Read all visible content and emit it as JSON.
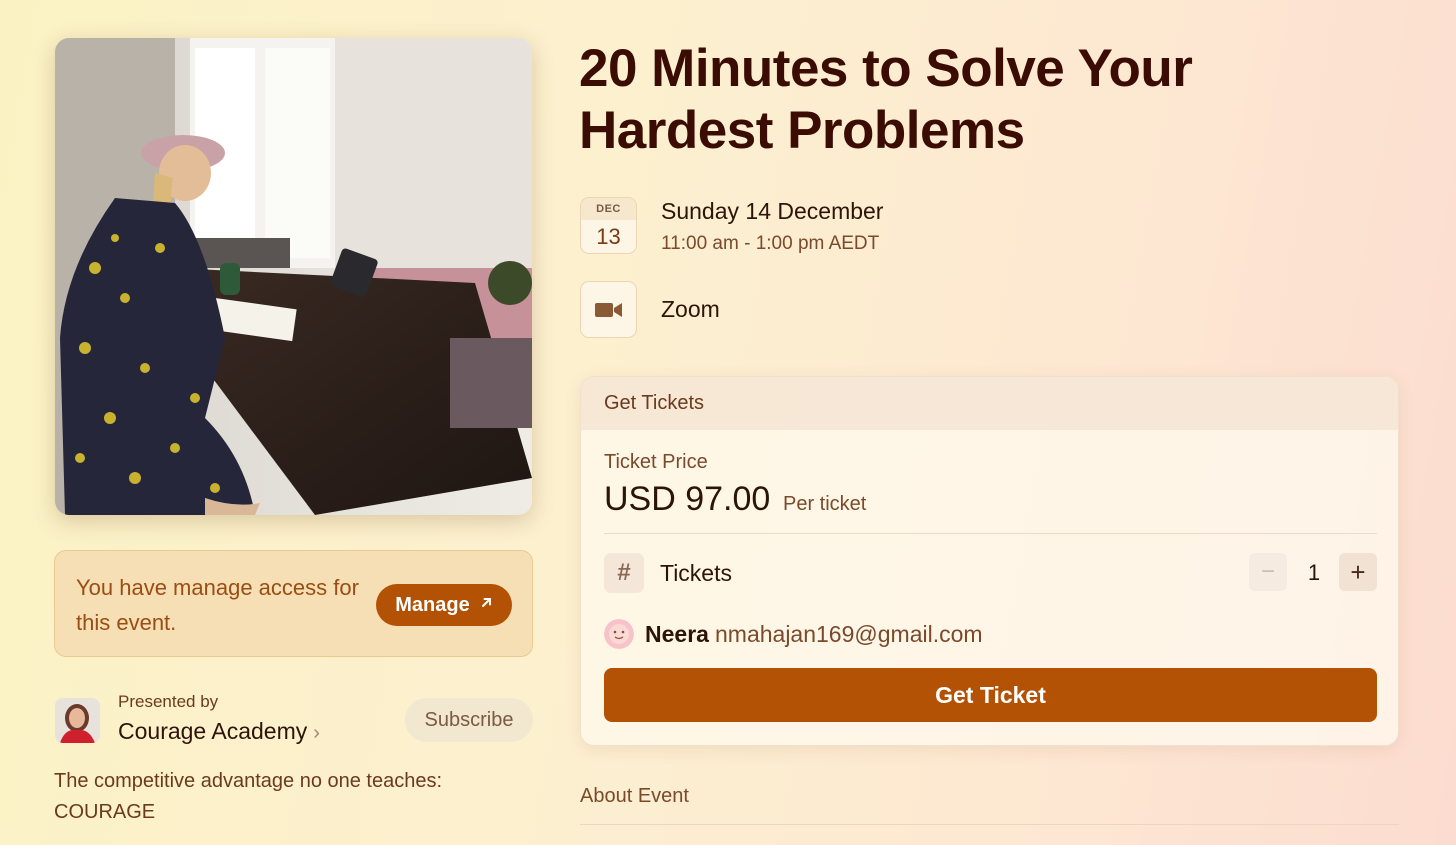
{
  "event": {
    "title": "20 Minutes to Solve Your Hardest Problems",
    "calendar": {
      "month": "DEC",
      "day": "13"
    },
    "date_main": "Sunday 14 December",
    "time": "11:00 am - 1:00 pm AEDT",
    "location": "Zoom",
    "location_icon": "video-camera-icon"
  },
  "manage": {
    "text": "You have manage access for this event.",
    "button_label": "Manage",
    "button_icon": "arrow-up-right-icon"
  },
  "host": {
    "presented_by": "Presented by",
    "name": "Courage Academy",
    "chevron": "›",
    "subscribe_label": "Subscribe",
    "description": "The competitive advantage no one teaches: COURAGE"
  },
  "tickets": {
    "header": "Get Tickets",
    "price_label": "Ticket Price",
    "price_value": "USD 97.00",
    "price_unit": "Per ticket",
    "hash": "#",
    "tickets_label": "Tickets",
    "quantity": "1",
    "minus": "−",
    "plus": "+",
    "user_name": "Neera",
    "user_email": "nmahajan169@gmail.com",
    "cta_label": "Get Ticket"
  },
  "about": {
    "heading": "About Event"
  },
  "colors": {
    "accent": "#b35205",
    "title": "#3a0c04",
    "text_muted": "#7a4a2a"
  }
}
